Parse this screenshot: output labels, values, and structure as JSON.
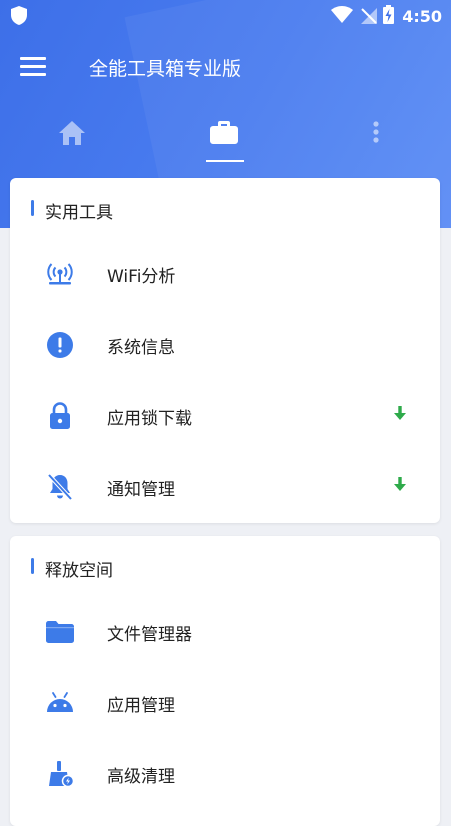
{
  "status_bar": {
    "time": "4:50"
  },
  "app_bar": {
    "title": "全能工具箱专业版"
  },
  "tabs": [
    {
      "icon": "home-icon"
    },
    {
      "icon": "briefcase-icon",
      "selected": true
    },
    {
      "icon": "more-vertical-icon"
    }
  ],
  "sections": [
    {
      "title": "实用工具",
      "items": [
        {
          "label": "WiFi分析",
          "icon": "wifi-router-icon",
          "download": false
        },
        {
          "label": "系统信息",
          "icon": "alert-circle-icon",
          "download": false
        },
        {
          "label": "应用锁下载",
          "icon": "lock-icon",
          "download": true
        },
        {
          "label": "通知管理",
          "icon": "notifications-off-icon",
          "download": true
        }
      ]
    },
    {
      "title": "释放空间",
      "items": [
        {
          "label": "文件管理器",
          "icon": "folder-icon"
        },
        {
          "label": "应用管理",
          "icon": "android-icon"
        },
        {
          "label": "高级清理",
          "icon": "broom-icon"
        }
      ]
    }
  ],
  "colors": {
    "primary": "#3d6fe8",
    "icon_blue": "#3d7be8",
    "download_green": "#2eaa4a",
    "background": "#eef0f5"
  }
}
